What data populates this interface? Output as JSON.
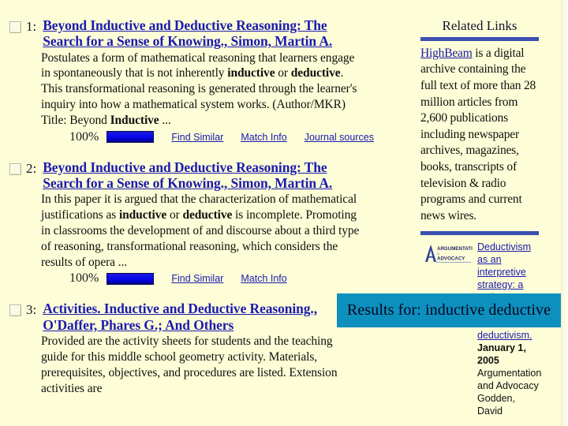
{
  "background_color": "#fdfdd7",
  "banner": {
    "text": "Results for: inductive deductive",
    "background_color": "#0d90bd",
    "text_color": "#050520"
  },
  "results": [
    {
      "number": "1:",
      "title": "Beyond Inductive and Deductive Reasoning: The Search for a Sense of Knowing., Simon, Martin A.",
      "snippet_pre": "Postulates a form of mathematical reasoning that learners engage in spontaneously that is not inherently ",
      "bold1": "inductive",
      "snippet_mid": " or ",
      "bold2": "deductive",
      "snippet_post": ". This transformational reasoning is generated through the learner's inquiry into how a mathematical system works. (Author/MKR) Title: Beyond ",
      "bold3": "Inductive",
      "snippet_end": " ...",
      "percent": "100%",
      "links": [
        "Find Similar",
        "Match Info",
        "Journal sources"
      ]
    },
    {
      "number": "2:",
      "title": "Beyond Inductive and Deductive Reasoning: The Search for a Sense of Knowing., Simon, Martin A.",
      "snippet_pre": "In this paper it is argued that the characterization of mathematical justifications as ",
      "bold1": "inductive",
      "snippet_mid": " or ",
      "bold2": "deductive",
      "snippet_post": " is incomplete. Promoting in classrooms the development of and discourse about a third type of reasoning, transformational reasoning, which considers the results of opera ...",
      "percent": "100%",
      "links": [
        "Find Similar",
        "Match Info"
      ]
    },
    {
      "number": "3:",
      "title": "Activities. Inductive and Deductive Reasoning., O'Daffer, Phares G.; And Others",
      "snippet_pre": "Provided are the activity sheets for students and the teaching guide for this middle school geometry activity. Materials, prerequisites, objectives, and procedures are listed. Extension activities are"
    }
  ],
  "sidebar": {
    "title": "Related Links",
    "rule_color": "#3a4fb0",
    "highbeam_link": "HighBeam",
    "highbeam_text": " is a digital archive containing the full text of more than 28 million articles from 2,600 publications including newspaper archives, magazines, books, transcripts of television & radio programs and current news wires.",
    "promo": {
      "logo_line1": "ARGUMENTATION",
      "logo_line2": "ADVOCACY",
      "link_text": "Deductivism as an interpretive strategy: a reply to Groarke on reconstructive deductivism.",
      "date": "January 1, 2005",
      "source": "Argumentation and Advocacy",
      "author": "Godden, David"
    }
  }
}
